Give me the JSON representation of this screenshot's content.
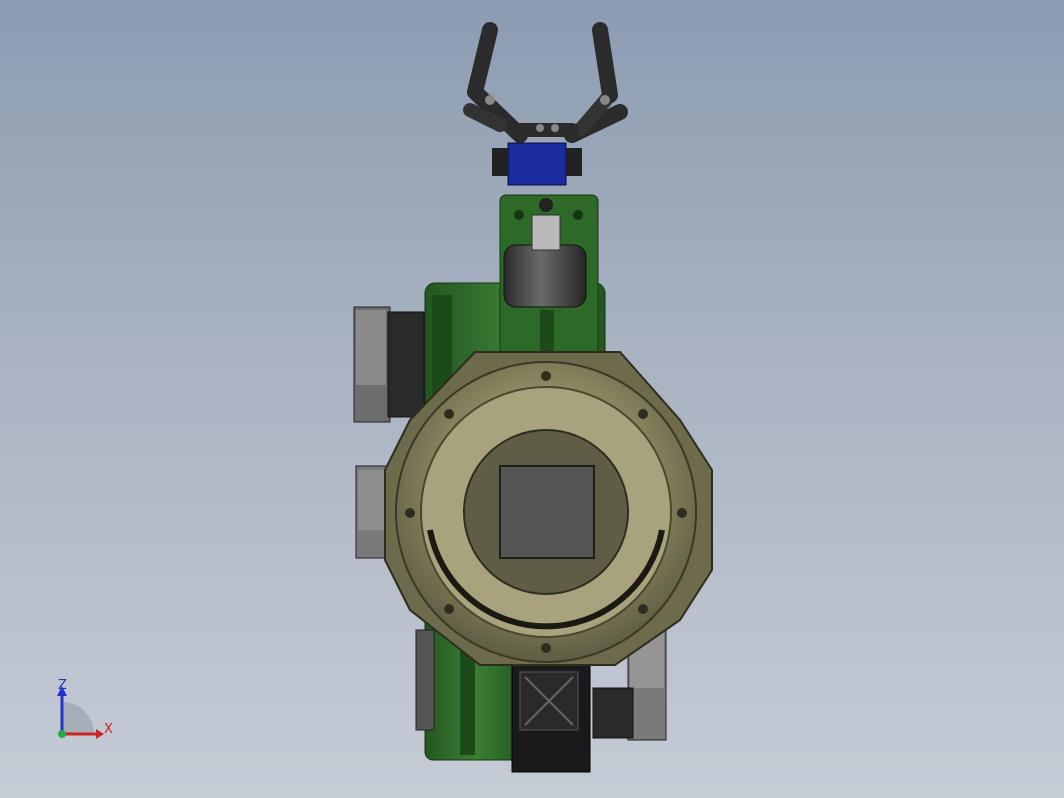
{
  "viewport": {
    "background_top": "#8c9cb1",
    "background_bottom": "#c6ccd6"
  },
  "model": {
    "body_color": "#2f6b2c",
    "bearing_color": "#8b8766",
    "motor_color": "#555555",
    "servo_color": "#1b2a9c",
    "gripper_color": "#2b2b2b"
  },
  "triad": {
    "z_label": "Z",
    "x_label": "X",
    "z_color": "#2233cc",
    "x_color": "#cc2222",
    "y_color": "#22aa44"
  }
}
